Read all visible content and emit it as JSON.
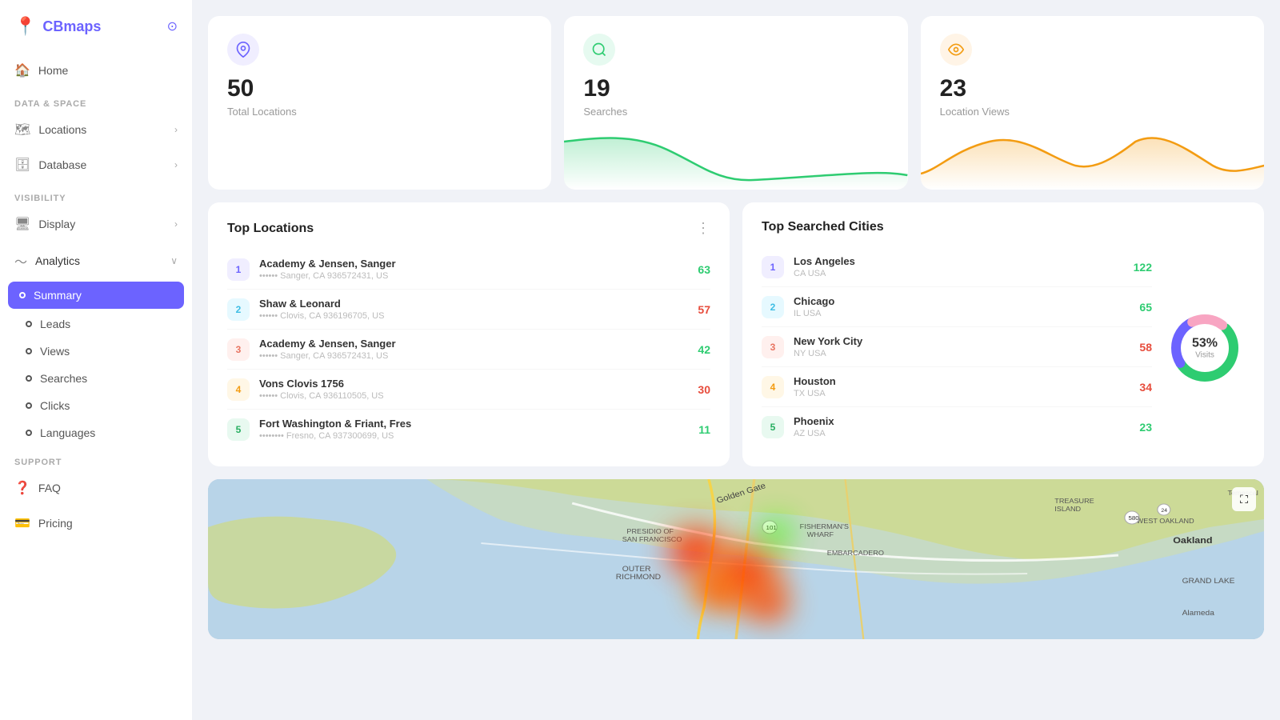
{
  "app": {
    "name": "CBmaps"
  },
  "sidebar": {
    "sections": [
      {
        "label": "",
        "items": [
          {
            "id": "home",
            "label": "Home",
            "icon": "🏠",
            "hasArrow": false
          }
        ]
      },
      {
        "label": "DATA & SPACE",
        "items": [
          {
            "id": "locations",
            "label": "Locations",
            "icon": "🗺",
            "hasArrow": true
          },
          {
            "id": "database",
            "label": "Database",
            "icon": "🗄",
            "hasArrow": true
          }
        ]
      },
      {
        "label": "VISIBILITY",
        "items": [
          {
            "id": "display",
            "label": "Display",
            "icon": "🖥",
            "hasArrow": true
          },
          {
            "id": "analytics",
            "label": "Analytics",
            "icon": "📈",
            "hasArrow": true,
            "hasChildren": true
          }
        ]
      }
    ],
    "analytics_children": [
      {
        "id": "summary",
        "label": "Summary",
        "active": true
      },
      {
        "id": "leads",
        "label": "Leads",
        "active": false
      },
      {
        "id": "views",
        "label": "Views",
        "active": false
      },
      {
        "id": "searches",
        "label": "Searches",
        "active": false
      },
      {
        "id": "clicks",
        "label": "Clicks",
        "active": false
      },
      {
        "id": "languages",
        "label": "Languages",
        "active": false
      }
    ],
    "support_label": "SUPPORT",
    "support_items": [
      {
        "id": "faq",
        "label": "FAQ",
        "icon": "❓"
      },
      {
        "id": "pricing",
        "label": "Pricing",
        "icon": "💳"
      }
    ]
  },
  "stats": {
    "locations": {
      "value": "50",
      "label": "Total Locations"
    },
    "searches": {
      "value": "19",
      "label": "Searches"
    },
    "views": {
      "value": "23",
      "label": "Location Views"
    }
  },
  "top_locations": {
    "title": "Top Locations",
    "items": [
      {
        "rank": 1,
        "name": "Academy & Jensen, Sanger",
        "address": "•••••• Sanger, CA 936572431, US",
        "score": "63",
        "color": "green"
      },
      {
        "rank": 2,
        "name": "Shaw & Leonard",
        "address": "•••••• Clovis, CA 936196705, US",
        "score": "57",
        "color": "red"
      },
      {
        "rank": 3,
        "name": "Academy & Jensen, Sanger",
        "address": "•••••• Sanger, CA 936572431, US",
        "score": "42",
        "color": "green"
      },
      {
        "rank": 4,
        "name": "Vons Clovis 1756",
        "address": "•••••• Clovis, CA 936110505, US",
        "score": "30",
        "color": "red"
      },
      {
        "rank": 5,
        "name": "Fort Washington & Friant, Fres",
        "address": "•••••••• Fresno, CA 937300699, US",
        "score": "11",
        "color": "green"
      }
    ]
  },
  "top_cities": {
    "title": "Top Searched Cities",
    "donut_pct": "53%",
    "donut_label": "Visits",
    "items": [
      {
        "rank": 1,
        "name": "Los Angeles",
        "sub": "CA USA",
        "score": "122",
        "color": "green"
      },
      {
        "rank": 2,
        "name": "Chicago",
        "sub": "IL USA",
        "score": "65",
        "color": "green"
      },
      {
        "rank": 3,
        "name": "New York City",
        "sub": "NY USA",
        "score": "58",
        "color": "red"
      },
      {
        "rank": 4,
        "name": "Houston",
        "sub": "TX USA",
        "score": "34",
        "color": "red"
      },
      {
        "rank": 5,
        "name": "Phoenix",
        "sub": "AZ USA",
        "score": "23",
        "color": "green"
      }
    ]
  }
}
